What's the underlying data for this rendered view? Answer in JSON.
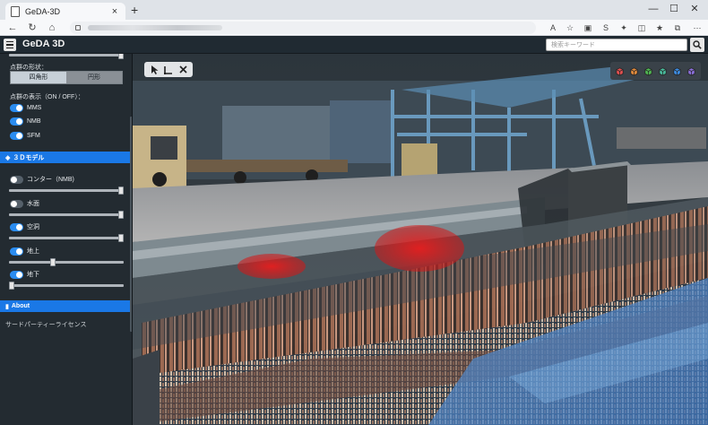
{
  "browser": {
    "tab_title": "GeDA-3D",
    "new_tab": "+",
    "window_controls": {
      "minimize": "—",
      "maximize": "☐",
      "close": "✕"
    }
  },
  "app": {
    "title": "GeDA 3D",
    "search_placeholder": "検索キーワード"
  },
  "sidebar": {
    "shape_label": "点群の形状：",
    "shape_options": {
      "square": "四角形",
      "circle": "円形"
    },
    "shape_selected": "四角形",
    "display_label": "点群の表示（ON / OFF）：",
    "pointclouds": [
      {
        "label": "MMS",
        "on": true
      },
      {
        "label": "NMB",
        "on": true
      },
      {
        "label": "SFM",
        "on": true
      }
    ],
    "model_section": "３Ｄモデル",
    "models": [
      {
        "label": "コンター（NMB)",
        "on": false,
        "slider": 1.0
      },
      {
        "label": "水面",
        "on": false,
        "slider": 1.0
      },
      {
        "label": "空洞",
        "on": true,
        "slider": 1.0
      },
      {
        "label": "地上",
        "on": true,
        "slider": 0.38
      },
      {
        "label": "地下",
        "on": true,
        "slider": 0.0
      }
    ],
    "about_section": "About",
    "license_link": "サードパーティーライセンス"
  },
  "viewer": {
    "tools": [
      "select-arrow",
      "measure-angle",
      "clear"
    ],
    "cube_colors": [
      "#e05050",
      "#e08a3c",
      "#4fb552",
      "#49b89a",
      "#3d8be0",
      "#8a6fd8"
    ]
  },
  "colors": {
    "accent": "#1a78e6",
    "header_bg": "#202a32",
    "sidebar_bg": "#232b31"
  }
}
